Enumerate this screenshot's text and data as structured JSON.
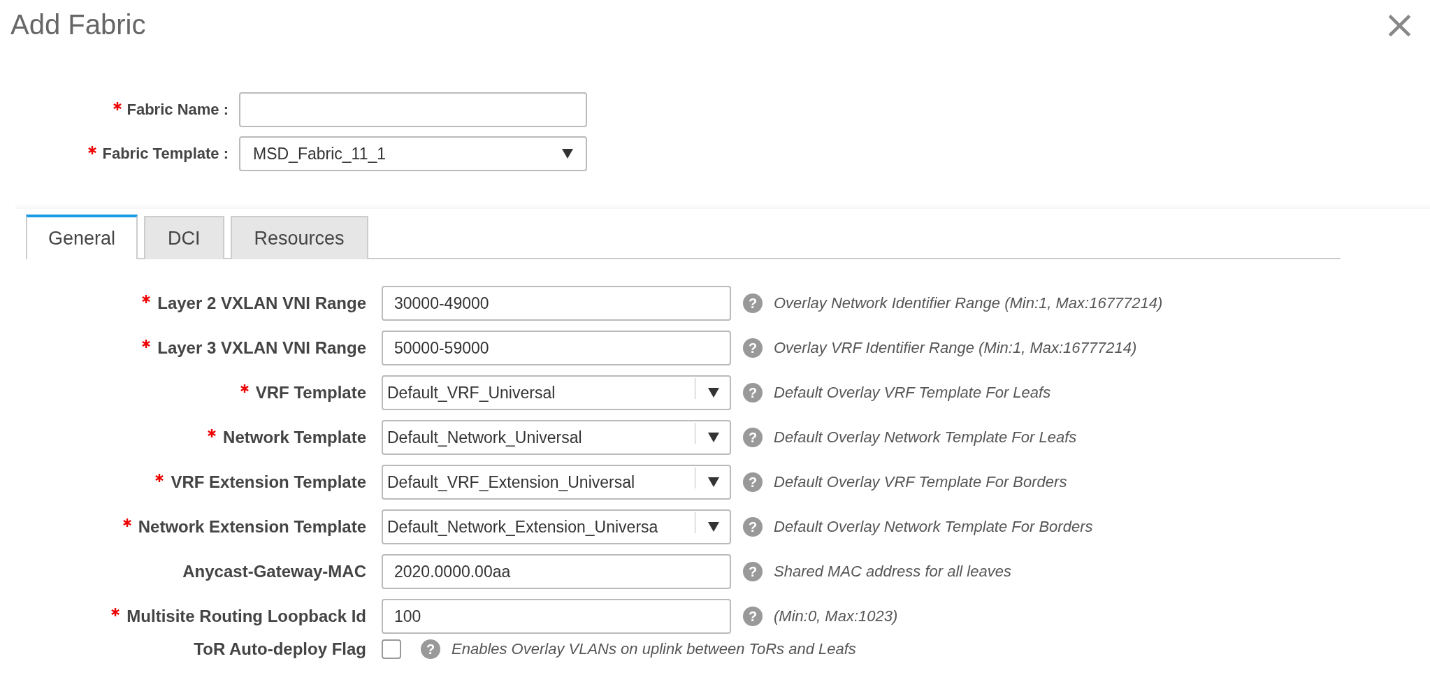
{
  "dialog": {
    "title": "Add Fabric",
    "close": "×"
  },
  "top_fields": [
    {
      "kind": "text",
      "label": "Fabric Name :",
      "required": true
    },
    {
      "kind": "select",
      "label": "Fabric Template :",
      "required": true,
      "value": "MSD_Fabric_11_1"
    }
  ],
  "tabs": [
    {
      "label": "General",
      "selected": true
    },
    {
      "label": "DCI",
      "selected": false
    },
    {
      "label": "Resources",
      "selected": false
    }
  ],
  "fields": [
    {
      "kind": "text",
      "label": "Layer 2 VXLAN VNI Range",
      "required": true,
      "value": "30000-49000",
      "help_icon": "?",
      "help": "Overlay Network Identifier Range (Min:1, Max:16777214)"
    },
    {
      "kind": "text",
      "label": "Layer 3 VXLAN VNI Range",
      "required": true,
      "value": "50000-59000",
      "help_icon": "?",
      "help": "Overlay VRF Identifier Range (Min:1, Max:16777214)"
    },
    {
      "kind": "select",
      "label": "VRF Template",
      "required": true,
      "value": "Default_VRF_Universal",
      "help_icon": "?",
      "help": "Default Overlay VRF Template For Leafs"
    },
    {
      "kind": "select",
      "label": "Network Template",
      "required": true,
      "value": "Default_Network_Universal",
      "help_icon": "?",
      "help": "Default Overlay Network Template For Leafs"
    },
    {
      "kind": "select",
      "label": "VRF Extension Template",
      "required": true,
      "value": "Default_VRF_Extension_Universal",
      "help_icon": "?",
      "help": "Default Overlay VRF Template For Borders"
    },
    {
      "kind": "select",
      "label": "Network Extension Template",
      "required": true,
      "value": "Default_Network_Extension_Universa",
      "help_icon": "?",
      "help": "Default Overlay Network Template For Borders"
    },
    {
      "kind": "text",
      "label": "Anycast-Gateway-MAC",
      "required": false,
      "value": "2020.0000.00aa",
      "help_icon": "?",
      "help": "Shared MAC address for all leaves"
    },
    {
      "kind": "text",
      "label": "Multisite Routing Loopback Id",
      "required": true,
      "value": "100",
      "help_icon": "?",
      "help": "(Min:0, Max:1023)"
    },
    {
      "kind": "checkbox",
      "label": "ToR Auto-deploy Flag",
      "required": false,
      "checked": false,
      "help_icon": "?",
      "help": "Enables Overlay VLANs on uplink between ToRs and Leafs"
    }
  ]
}
